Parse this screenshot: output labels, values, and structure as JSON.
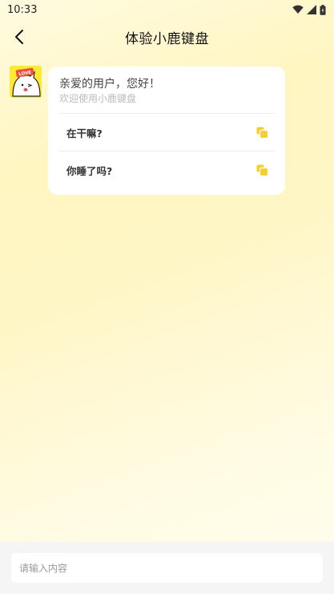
{
  "status_bar": {
    "time": "10:33",
    "icons": [
      "wifi-icon",
      "signal-icon",
      "battery-icon"
    ]
  },
  "header": {
    "title": "体验小鹿键盘",
    "back_icon": "chevron-left-icon"
  },
  "chat": {
    "avatar_badge": "LOVE",
    "greeting": "亲爱的用户，您好！",
    "subtitle": "欢迎使用小鹿键盘",
    "suggestions": [
      {
        "text": "在干嘛?",
        "icon": "copy-icon"
      },
      {
        "text": "你睡了吗?",
        "icon": "copy-icon"
      }
    ]
  },
  "input": {
    "placeholder": "请输入内容",
    "value": ""
  },
  "colors": {
    "accent": "#f7cf2a",
    "background_top": "#fff6c2",
    "card": "#ffffff"
  }
}
